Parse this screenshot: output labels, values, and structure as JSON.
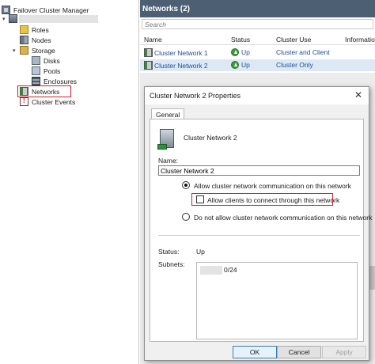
{
  "tree": {
    "root_label": "Failover Cluster Manager",
    "items": [
      {
        "label": "Roles",
        "icon": "roles-icon"
      },
      {
        "label": "Nodes",
        "icon": "nodes-icon"
      },
      {
        "label": "Storage",
        "icon": "storage-icon"
      },
      {
        "label": "Disks",
        "icon": "disks-icon"
      },
      {
        "label": "Pools",
        "icon": "pools-icon"
      },
      {
        "label": "Enclosures",
        "icon": "enclosures-icon"
      },
      {
        "label": "Networks",
        "icon": "networks-icon"
      },
      {
        "label": "Cluster Events",
        "icon": "cluster-events-icon"
      }
    ]
  },
  "networks_pane": {
    "title": "Networks (2)",
    "search_placeholder": "Search",
    "columns": [
      "Name",
      "Status",
      "Cluster Use",
      "Information"
    ],
    "rows": [
      {
        "name": "Cluster Network 1",
        "status": "Up",
        "cluster_use": "Cluster and Client"
      },
      {
        "name": "Cluster Network 2",
        "status": "Up",
        "cluster_use": "Cluster Only"
      }
    ]
  },
  "dialog": {
    "title": "Cluster Network 2 Properties",
    "close_glyph": "✕",
    "tab": "General",
    "network_name": "Cluster Network 2",
    "name_label": "Name:",
    "name_value": "Cluster Network 2",
    "radio_allow": "Allow cluster network communication on this network",
    "checkbox_clients": "Allow clients to connect through this network",
    "radio_disallow": "Do not allow cluster network communication on this network",
    "status_label": "Status:",
    "status_value": "Up",
    "subnets_label": "Subnets:",
    "subnet_value": "0/24",
    "ok": "OK",
    "cancel": "Cancel",
    "apply": "Apply"
  },
  "colors": {
    "header_bg": "#4d5f73",
    "selection_bg": "#dce9f5",
    "highlight_red": "#d0202a",
    "link_blue": "#1b4f9a"
  }
}
